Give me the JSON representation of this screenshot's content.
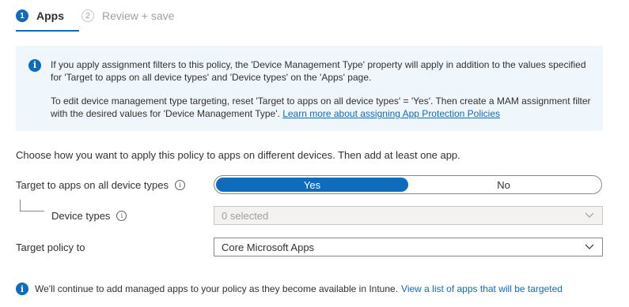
{
  "stepper": {
    "steps": [
      {
        "number": "1",
        "label": "Apps",
        "active": true
      },
      {
        "number": "2",
        "label": "Review + save",
        "active": false
      }
    ]
  },
  "banner": {
    "icon": "info-icon",
    "paragraph1": "If you apply assignment filters to this policy, the 'Device Management Type' property will apply in addition to the values specified for 'Target to apps on all device types' and 'Device types' on the 'Apps' page.",
    "paragraph2_text": "To edit device management type targeting, reset 'Target to apps on all device types' = 'Yes'. Then create a MAM assignment filter with the desired values for 'Device Management Type'. ",
    "paragraph2_link": "Learn more about assigning App Protection Policies"
  },
  "instruction": "Choose how you want to apply this policy to apps on different devices. Then add at least one app.",
  "target_all": {
    "label": "Target to apps on all device types",
    "options": [
      "Yes",
      "No"
    ],
    "selected": "Yes"
  },
  "device_types": {
    "label": "Device types",
    "value": "0 selected"
  },
  "target_policy": {
    "label": "Target policy to",
    "value": "Core Microsoft Apps"
  },
  "footer": {
    "text": "We'll continue to add managed apps to your policy as they become available in Intune.",
    "link": "View a list of apps that will be targeted"
  },
  "colors": {
    "accent": "#0f6cbd",
    "banner_bg": "#eff6fc",
    "text": "#323130",
    "muted": "#a19f9d"
  }
}
